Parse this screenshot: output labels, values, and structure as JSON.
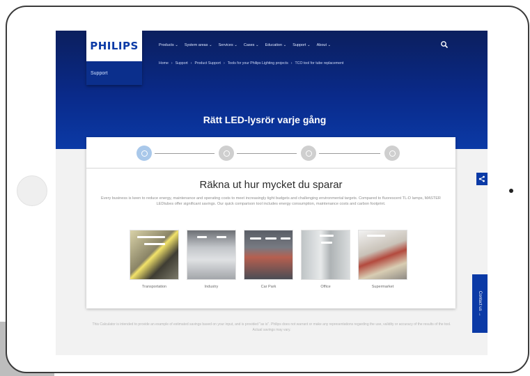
{
  "brand": {
    "logo_text": "PHILIPS",
    "section": "Support",
    "accent": "#0b3aa6"
  },
  "nav": {
    "items": [
      "Products ⌄",
      "System areas ⌄",
      "Services ⌄",
      "Cases ⌄",
      "Education ⌄",
      "Support ⌄",
      "About ⌄"
    ]
  },
  "breadcrumb": {
    "items": [
      "Home",
      "Support",
      "Product Support",
      "Tools for your Philips Lighting projects",
      "TCO tool for tube replacement"
    ]
  },
  "hero": {
    "title": "Rätt LED-lysrör varje gång"
  },
  "card": {
    "title": "Räkna ut hur mycket du sparar",
    "description": "Every business is keen to reduce energy, maintenance and operating costs to meet increasingly tight budgets and challenging environmental targets. Compared to fluorescent TL-D lamps, MASTER LEDtubes offer significant savings. Our quick comparison tool includes energy consumption, maintenance costs and carbon footprint.",
    "tiles": [
      "Transportation",
      "Industry",
      "Car Park",
      "Office",
      "Supermarket"
    ]
  },
  "footer": {
    "note": "This Calculator is intended to provide an example of estimated savings based on your input, and is provided \"as is\". Philips does not warrant or make any representations regarding the use, validity or accuracy of the results of the tool. Actual savings may vary."
  },
  "side": {
    "contact_label": "Contact us  →"
  },
  "icons": {
    "search": "search-icon",
    "share": "share-icon"
  }
}
